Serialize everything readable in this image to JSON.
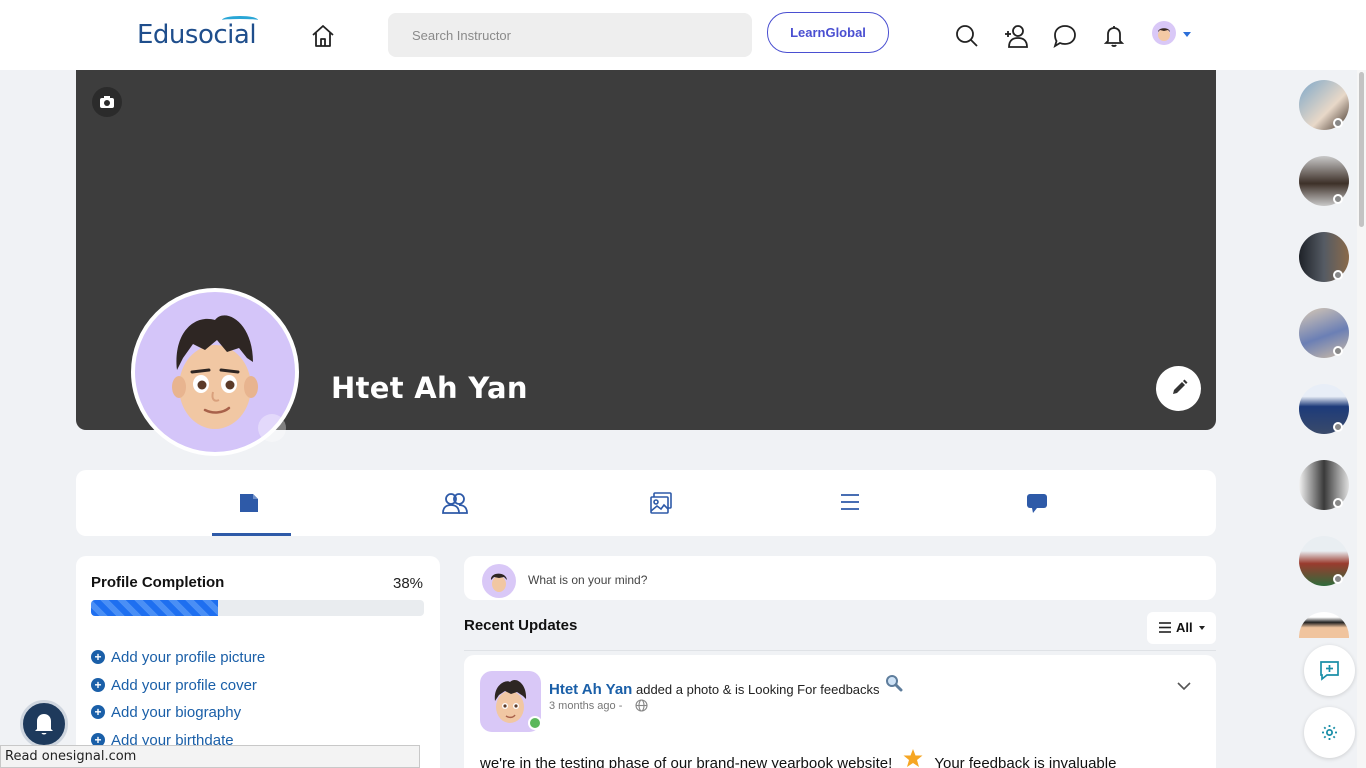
{
  "header": {
    "logo_text": "Edusocial",
    "search_placeholder": "Search Instructor",
    "learn_button": "LearnGlobal"
  },
  "profile": {
    "name": "Htet Ah Yan"
  },
  "profile_completion": {
    "title": "Profile Completion",
    "percent_label": "38%",
    "percent_value": 38,
    "items": [
      "Add your profile picture",
      "Add your profile cover",
      "Add your biography",
      "Add your birthdate"
    ]
  },
  "composer": {
    "placeholder": "What is on your mind?"
  },
  "feed": {
    "title": "Recent Updates",
    "filter_label": "All"
  },
  "post": {
    "author": "Htet Ah Yan",
    "action": "added a photo & is Looking For feedbacks",
    "time": "3 months ago -",
    "text_before": "we're in the testing phase of our brand-new yearbook website!",
    "text_after": "Your feedback is invaluable"
  },
  "status_bar": {
    "text": "Read onesignal.com"
  },
  "colors": {
    "accent": "#1a5fa8",
    "cover": "#3d3d3d",
    "progress": "#1e6ff0"
  }
}
